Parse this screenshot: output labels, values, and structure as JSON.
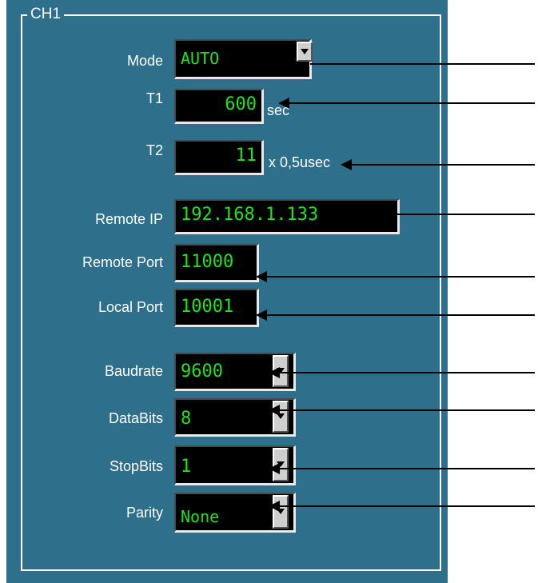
{
  "group_title": "CH1",
  "mode": {
    "label": "Mode",
    "value": "AUTO"
  },
  "t1": {
    "label": "T1",
    "value": "600",
    "unit": "sec"
  },
  "t2": {
    "label": "T2",
    "value": "11",
    "unit": "x 0,5usec"
  },
  "remote_ip": {
    "label": "Remote IP",
    "value": "192.168.1.133"
  },
  "remote_port": {
    "label": "Remote Port",
    "value": "11000"
  },
  "local_port": {
    "label": "Local Port",
    "value": "10001"
  },
  "baudrate": {
    "label": "Baudrate",
    "value": "9600"
  },
  "databits": {
    "label": "DataBits",
    "value": "8"
  },
  "stopbits": {
    "label": "StopBits",
    "value": "1"
  },
  "parity": {
    "label": "Parity",
    "value": "None"
  },
  "colors": {
    "panel": "#2e6f8c",
    "field_bg": "#000000",
    "field_text": "#19e619",
    "label_text": "#ffffff"
  }
}
